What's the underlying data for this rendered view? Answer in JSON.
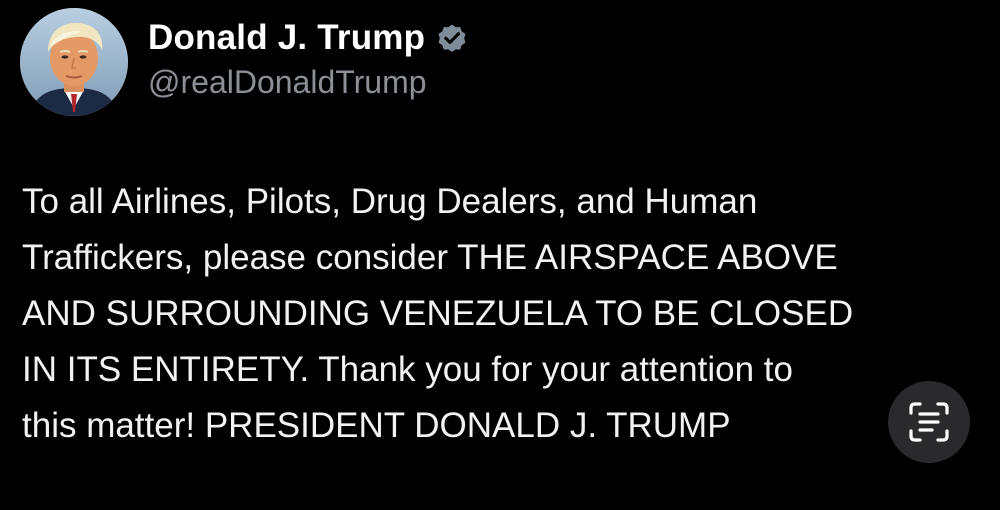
{
  "post": {
    "author": {
      "display_name": "Donald J. Trump",
      "handle": "@realDonaldTrump",
      "verified": true,
      "verified_badge_color": "#7f8c99"
    },
    "body_lines": [
      "To all Airlines, Pilots, Drug Dealers, and Human",
      "Traffickers, please consider THE AIRSPACE ABOVE",
      "AND SURROUNDING VENEZUELA TO BE CLOSED",
      "IN ITS ENTIRETY. Thank you for your attention to",
      "this matter! PRESIDENT DONALD J. TRUMP"
    ]
  },
  "overlay": {
    "text_scan_icon": "live-text-scan-icon"
  },
  "colors": {
    "background": "#000000",
    "text": "#f2f2f2",
    "handle": "#8b9096",
    "button_bg": "#2a2a2c"
  }
}
